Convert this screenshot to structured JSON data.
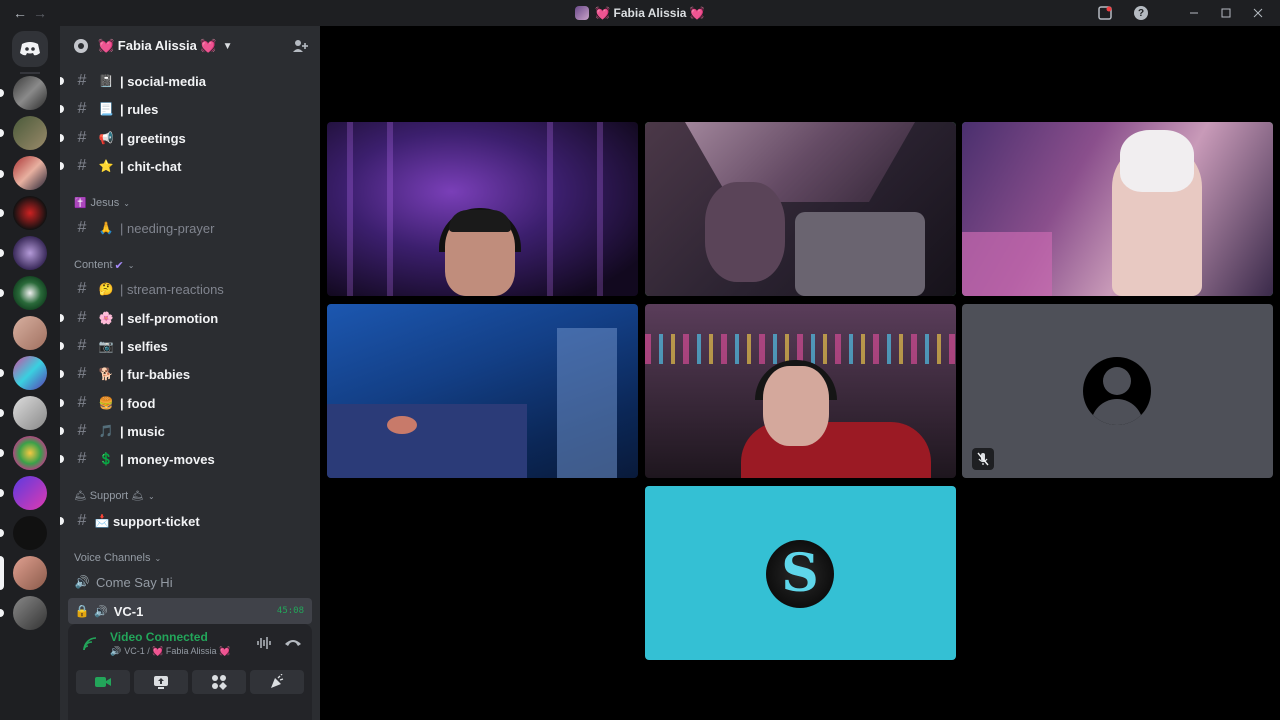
{
  "window": {
    "title": "💓 Fabia Alissia 💓"
  },
  "server": {
    "name": "💓 Fabia Alissia 💓"
  },
  "channels": [
    {
      "emoji": "📓",
      "label": "| social-media"
    },
    {
      "emoji": "📃",
      "label": "| rules"
    },
    {
      "emoji": "📢",
      "label": "| greetings"
    },
    {
      "emoji": "⭐",
      "label": "| chit-chat"
    }
  ],
  "categories": {
    "jesus": "Jesus",
    "content": "Content",
    "support": "Support",
    "voice": "Voice Channels"
  },
  "jesus_channels": [
    {
      "emoji": "🙏",
      "label": "| needing-prayer"
    }
  ],
  "content_channels": [
    {
      "emoji": "🤔",
      "label": "| stream-reactions"
    },
    {
      "emoji": "🌸",
      "label": "| self-promotion"
    },
    {
      "emoji": "📷",
      "label": "| selfies"
    },
    {
      "emoji": "🐕",
      "label": "| fur-babies"
    },
    {
      "emoji": "🍔",
      "label": "| food"
    },
    {
      "emoji": "🎵",
      "label": "| music"
    },
    {
      "emoji": "💲",
      "label": "| money-moves"
    }
  ],
  "support_channels": [
    {
      "emoji": "📩",
      "label": "support-ticket"
    }
  ],
  "voice_channels": [
    {
      "label": "Come Say Hi"
    },
    {
      "label": "VC-1",
      "timer": "45:08"
    }
  ],
  "voice_panel": {
    "status": "Video Connected",
    "sub": "VC-1 / 💓 Fabia Alissia 💓"
  },
  "colors": {
    "accent_green": "#23a55a",
    "sidebar_bg": "#2b2d31",
    "rail_bg": "#1e1f22",
    "stage_bg": "#000000",
    "empty_tile": "#4e5058",
    "cyan_tile": "#34c0d4"
  },
  "icons": {
    "back": "arrow-left-icon",
    "forward": "arrow-right-icon",
    "inbox": "inbox-icon",
    "help": "help-icon",
    "invite": "add-member-icon",
    "camera": "camera-icon",
    "share": "screen-share-icon",
    "activities": "activities-icon",
    "soundboard": "soundboard-icon"
  }
}
